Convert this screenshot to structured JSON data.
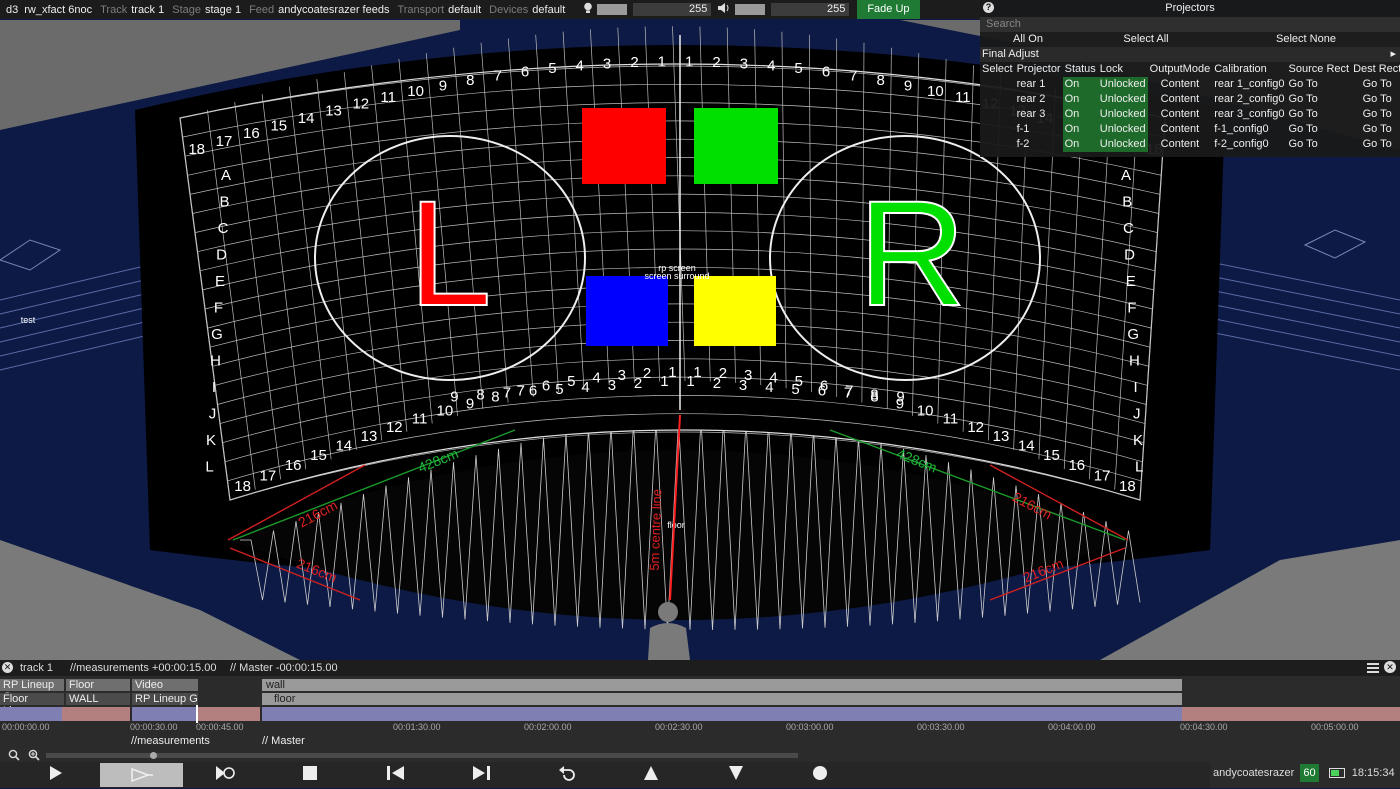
{
  "topbar": {
    "app": "d3",
    "project": "rw_xfact 6noc",
    "track_label": "Track",
    "track": "track 1",
    "stage_label": "Stage",
    "stage": "stage 1",
    "feed_label": "Feed",
    "feed": "andycoatesrazer feeds",
    "transport_label": "Transport",
    "transport": "default",
    "devices_label": "Devices",
    "devices": "default",
    "brightness": "255",
    "volume": "255",
    "fade_button": "Fade Up"
  },
  "projectors": {
    "title": "Projectors",
    "search_placeholder": "Search",
    "all_on": "All On",
    "select_all": "Select All",
    "select_none": "Select None",
    "final_adjust": "Final Adjust",
    "columns": [
      "Select",
      "Projector",
      "Status",
      "Lock",
      "OutputMode",
      "Calibration",
      "Source Rect",
      "Dest Rect"
    ],
    "rows": [
      {
        "name": "rear 1",
        "status": "On",
        "lock": "Unlocked",
        "mode": "Content",
        "calibration": "rear 1_config0",
        "source": "Go To",
        "dest": "Go To"
      },
      {
        "name": "rear 2",
        "status": "On",
        "lock": "Unlocked",
        "mode": "Content",
        "calibration": "rear 2_config0",
        "source": "Go To",
        "dest": "Go To"
      },
      {
        "name": "rear 3",
        "status": "On",
        "lock": "Unlocked",
        "mode": "Content",
        "calibration": "rear 3_config0",
        "source": "Go To",
        "dest": "Go To"
      },
      {
        "name": "f-1",
        "status": "On",
        "lock": "Unlocked",
        "mode": "Content",
        "calibration": "f-1_config0",
        "source": "Go To",
        "dest": "Go To"
      },
      {
        "name": "f-2",
        "status": "On",
        "lock": "Unlocked",
        "mode": "Content",
        "calibration": "f-2_config0",
        "source": "Go To",
        "dest": "Go To"
      }
    ]
  },
  "viewport": {
    "rows": [
      "A",
      "B",
      "C",
      "D",
      "E",
      "F",
      "G",
      "H",
      "I",
      "J",
      "K",
      "L"
    ],
    "left_big_letter": "L",
    "right_big_letter": "R",
    "label_rp_screen": "rp screen",
    "label_screen_surround": "screen surround",
    "label_test": "test",
    "label_floor": "floor",
    "label_centre": "5m centre line",
    "dim_428": "428cm",
    "dim_216": "216cm",
    "dim_21": "216cm",
    "colors": {
      "red": "#ff0000",
      "green": "#00e000",
      "blue": "#0000ff",
      "yellow": "#ffff00"
    }
  },
  "timeline": {
    "track": "track 1",
    "measurements_pos": "//measurements +00:00:15.00",
    "master_pos": "// Master -00:00:15.00",
    "layers": [
      {
        "a": "RP Lineup G",
        "b": "Floor",
        "c": "Video"
      },
      {
        "a": "Floor Lineup",
        "b": "WALL",
        "c": "RP Lineup G"
      }
    ],
    "bar_wall": "wall",
    "bar_floor": "floor",
    "times": [
      "00:00:00.00",
      "00:00:30.00",
      "00:00:45.00",
      "00:01:30.00",
      "00:02:00.00",
      "00:02:30.00",
      "00:03:00.00",
      "00:03:30.00",
      "00:04:00.00",
      "00:04:30.00",
      "00:05:00.00"
    ],
    "section_measurements": "//measurements",
    "section_master": "// Master"
  },
  "status": {
    "user": "andycoatesrazer",
    "fps": "60",
    "clock": "18:15:34"
  }
}
